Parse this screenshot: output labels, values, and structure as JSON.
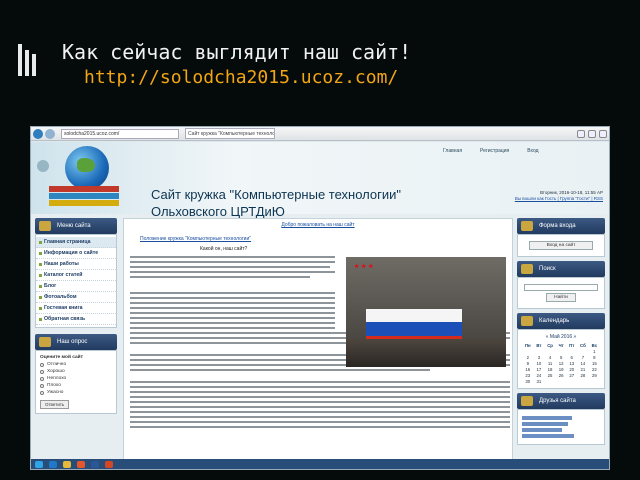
{
  "slide": {
    "title": "Как сейчас выглядит наш сайт!",
    "url": "http://solodcha2015.ucoz.com/"
  },
  "browser": {
    "address": "solodcha2015.ucoz.com/",
    "tab": "Сайт кружка \"Компьютерные технологии\""
  },
  "site": {
    "title_line1": "Сайт кружка \"Компьютерные технологии\"",
    "title_line2": "Ольховского ЦРТДиЮ",
    "top_nav": [
      "Главная",
      "Регистрация",
      "Вход"
    ],
    "meta": {
      "date_line": "Вторник, 2016-10-18, 11:55 AP",
      "greet_line": "Вы вошли как Гость | Группа \"Гости\" | RSS"
    }
  },
  "sidebar_left": {
    "menu_title": "Меню сайта",
    "menu_items": [
      "Главная страница",
      "Информация о сайте",
      "Наши работы",
      "Каталог статей",
      "Блог",
      "Фотоальбом",
      "Гостевая книга",
      "Обратная связь"
    ],
    "poll_title": "Наш опрос",
    "poll_question": "Оцените мой сайт",
    "poll_options": [
      "Отлично",
      "Хорошо",
      "Неплохо",
      "Плохо",
      "Ужасно"
    ],
    "poll_button": "Ответить"
  },
  "content": {
    "header_link": "Добро пожаловать на наш сайт",
    "section_link": "Положение кружка \"Компьютерные технологии\"",
    "subtitle": "Какой он, наш сайт?"
  },
  "sidebar_right": {
    "form_title": "Форма входа",
    "form_button": "Вход на сайт",
    "search_title": "Поиск",
    "search_button": "Найти",
    "calendar_title": "Календарь",
    "calendar_month": "« Май 2016 »",
    "calendar_days": [
      "Пн",
      "Вт",
      "Ср",
      "Чт",
      "Пт",
      "Сб",
      "Вс"
    ],
    "calendar_rows": [
      [
        "",
        "",
        "",
        "",
        "",
        "",
        "1"
      ],
      [
        "2",
        "3",
        "4",
        "5",
        "6",
        "7",
        "8"
      ],
      [
        "9",
        "10",
        "11",
        "12",
        "13",
        "14",
        "15"
      ],
      [
        "16",
        "17",
        "18",
        "19",
        "20",
        "21",
        "22"
      ],
      [
        "23",
        "24",
        "25",
        "26",
        "27",
        "28",
        "29"
      ],
      [
        "30",
        "31",
        "",
        "",
        "",
        "",
        ""
      ]
    ],
    "friends_title": "Друзья сайта"
  }
}
